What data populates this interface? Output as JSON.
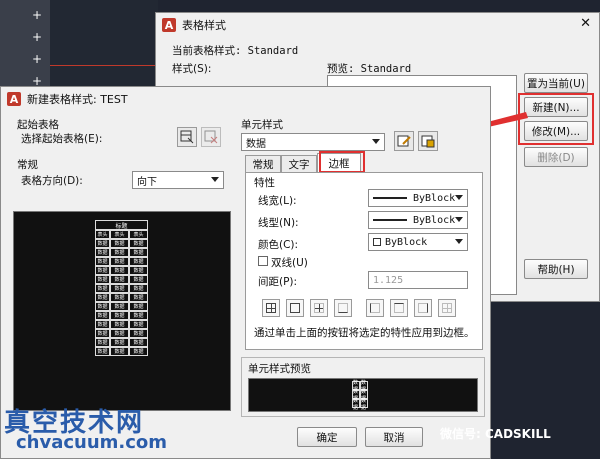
{
  "back_dialog": {
    "title": "表格样式",
    "current_style_label": "当前表格样式: Standard",
    "styles_label": "样式(S):",
    "preview_label": "预览: Standard",
    "set_current": "置为当前(U)",
    "new": "新建(N)...",
    "modify": "修改(M)...",
    "delete": "删除(D)",
    "help": "帮助(H)"
  },
  "front_dialog": {
    "title": "新建表格样式: TEST",
    "starting_table_header": "起始表格",
    "select_starting_table": "选择起始表格(E):",
    "general_header": "常规",
    "table_direction_label": "表格方向(D):",
    "table_direction_value": "向下",
    "cell_styles_header": "单元样式",
    "cell_style_value": "数据",
    "tabs": [
      "常规",
      "文字",
      "边框"
    ],
    "properties_header": "特性",
    "lineweight_label": "线宽(L):",
    "lineweight_value": "ByBlock",
    "linetype_label": "线型(N):",
    "linetype_value": "ByBlock",
    "color_label": "颜色(C):",
    "color_value": "ByBlock",
    "double_line_label": "双线(U)",
    "spacing_label": "间距(P):",
    "spacing_value": "1.125",
    "hint": "通过单击上面的按钮将选定的特性应用到边框。",
    "cell_preview_header": "单元样式预览",
    "table_preview_title": "标题",
    "table_preview_header_cell": "表头",
    "table_preview_data_cell": "数据",
    "ok": "确定",
    "cancel": "取消"
  },
  "watermark": {
    "brand_cn": "真空技术网",
    "brand_url": "chvacuum.com",
    "wechat": "微信号: CADSKILL"
  },
  "colors": {
    "highlight": "#e03030",
    "arrow": "#e03030",
    "autocad_red": "#c0392b"
  }
}
